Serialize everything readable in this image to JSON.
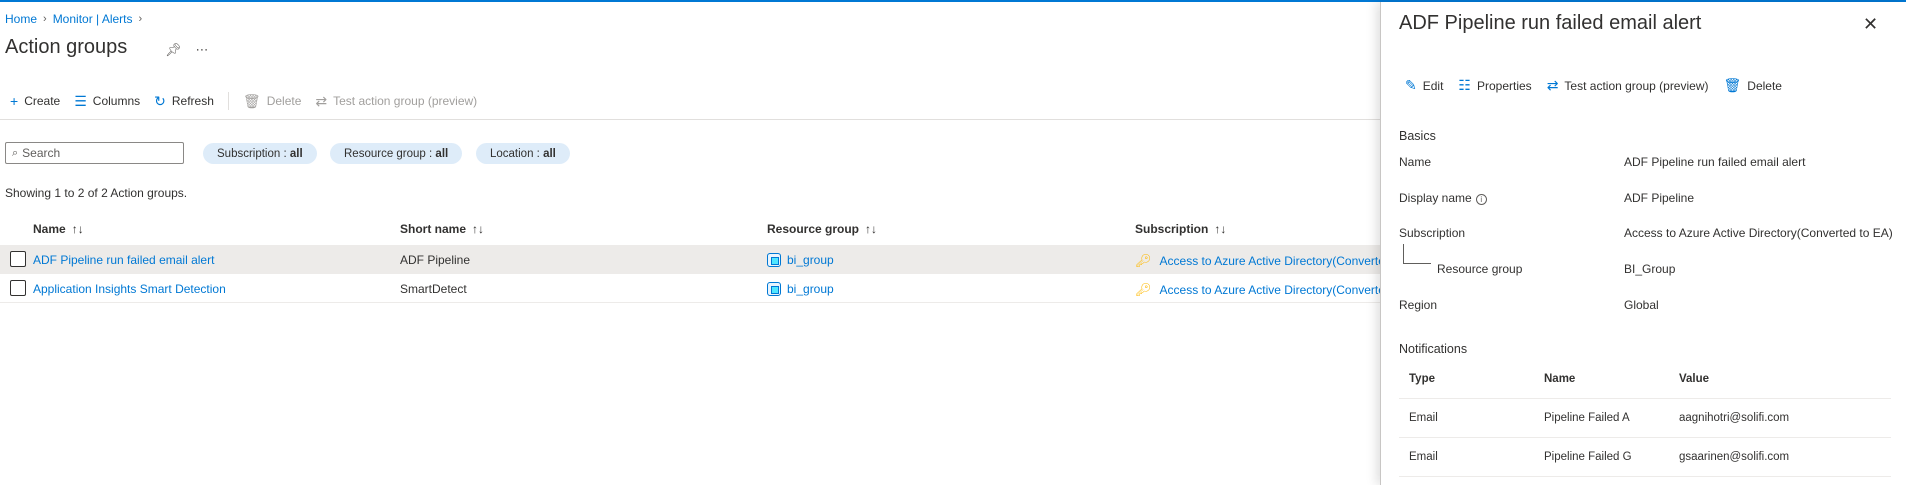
{
  "breadcrumb": {
    "home": "Home",
    "monitor": "Monitor | Alerts"
  },
  "page": {
    "title": "Action groups"
  },
  "toolbar": {
    "create": "Create",
    "columns": "Columns",
    "refresh": "Refresh",
    "delete": "Delete",
    "test": "Test action group (preview)"
  },
  "filters": {
    "search_placeholder": "Search",
    "subscription_label": "Subscription : ",
    "subscription_value": "all",
    "resource_group_label": "Resource group : ",
    "resource_group_value": "all",
    "location_label": "Location : ",
    "location_value": "all"
  },
  "count_text": "Showing 1 to 2 of 2 Action groups.",
  "grid": {
    "columns": [
      "Name",
      "Short name",
      "Resource group",
      "Subscription"
    ],
    "rows": [
      {
        "name": "ADF Pipeline run failed email alert",
        "short_name": "ADF Pipeline",
        "resource_group": "bi_group",
        "subscription": "Access to Azure Active Directory(Converted"
      },
      {
        "name": "Application Insights Smart Detection",
        "short_name": "SmartDetect",
        "resource_group": "bi_group",
        "subscription": "Access to Azure Active Directory(Converted"
      }
    ]
  },
  "panel": {
    "title": "ADF Pipeline run failed email alert",
    "toolbar": {
      "edit": "Edit",
      "properties": "Properties",
      "test": "Test action group (preview)",
      "delete": "Delete"
    },
    "basics_heading": "Basics",
    "basics": {
      "name_label": "Name",
      "name_value": "ADF Pipeline run failed email alert",
      "display_label": "Display name",
      "display_value": "ADF Pipeline",
      "subscription_label": "Subscription",
      "subscription_value": "Access to Azure Active Directory(Converted to EA)",
      "rg_label": "Resource group",
      "rg_value": "BI_Group",
      "region_label": "Region",
      "region_value": "Global"
    },
    "notifications_heading": "Notifications",
    "notifications": {
      "columns": [
        "Type",
        "Name",
        "Value"
      ],
      "rows": [
        {
          "type": "Email",
          "name": "Pipeline Failed A",
          "value": "aagnihotri@solifi.com"
        },
        {
          "type": "Email",
          "name": "Pipeline Failed G",
          "value": "gsaarinen@solifi.com"
        }
      ]
    }
  },
  "colors": {
    "accent": "#0078d4",
    "pill_bg": "#deecf9",
    "selected_row": "#edebe9"
  }
}
